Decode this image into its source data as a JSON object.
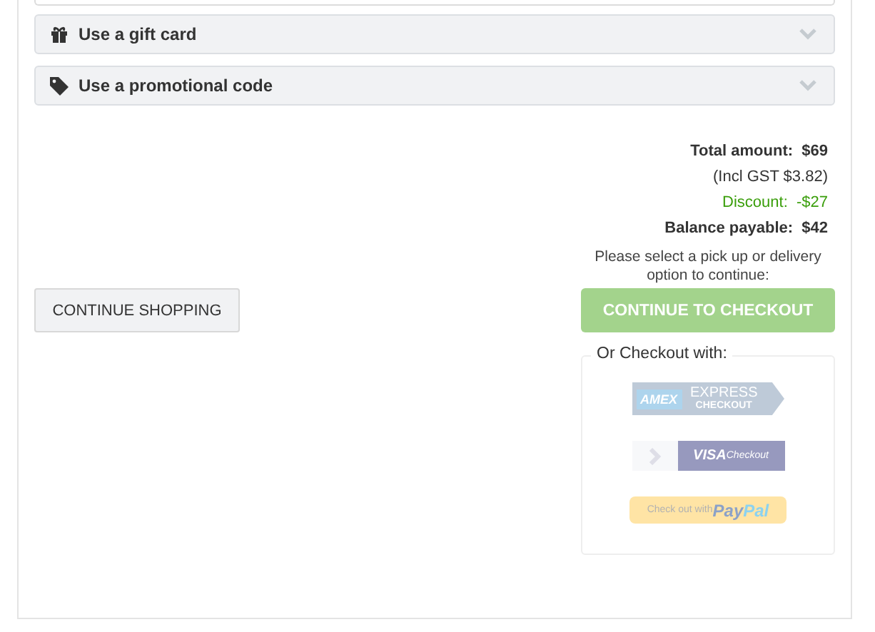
{
  "accordions": [
    {
      "kind": "gift",
      "label": "Use a gift card",
      "expanded": false
    },
    {
      "kind": "tag",
      "label": "Use a promotional code",
      "expanded": false
    }
  ],
  "totals": [
    {
      "kind": "bold",
      "label": "Total amount:",
      "value": "$69"
    },
    {
      "kind": "plain",
      "label": "(Incl GST $3.82)"
    },
    {
      "kind": "discount",
      "label": "Discount:",
      "value": "-$27"
    },
    {
      "kind": "bold",
      "label": "Balance payable:",
      "value": "$42"
    }
  ],
  "notice": "Please select a pick up or delivery option to continue:",
  "continue_shopping": {
    "label": "CONTINUE SHOPPING"
  },
  "checkout": {
    "label": "CONTINUE TO CHECKOUT",
    "disabled": true
  },
  "wallets": {
    "legend": "Or Checkout with:",
    "disabled": true,
    "options": [
      {
        "kind": "amex",
        "mark": "AMEX",
        "line1": "EXPRESS",
        "line2": "CHECKOUT"
      },
      {
        "kind": "visa",
        "mark": "VISA",
        "line1": "Checkout"
      },
      {
        "kind": "paypal",
        "line1": "Check out with",
        "mark": "Pay",
        "line2": "Pal"
      }
    ]
  }
}
